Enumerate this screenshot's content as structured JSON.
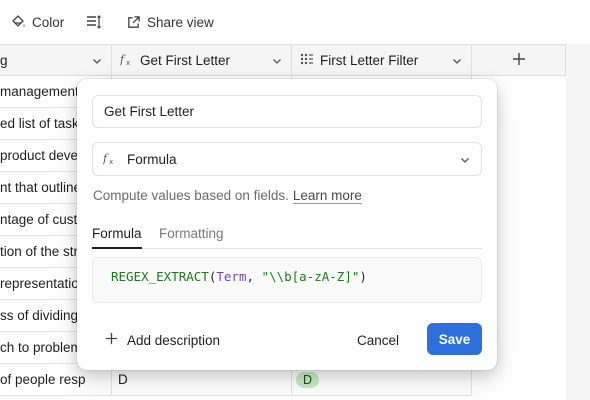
{
  "toolbar": {
    "color_label": "Color",
    "share_label": "Share view"
  },
  "columns": [
    {
      "label": "g"
    },
    {
      "label": "Get First Letter"
    },
    {
      "label": "First Letter Filter"
    }
  ],
  "rows": [
    {
      "c1": "management"
    },
    {
      "c1": "ed list of task"
    },
    {
      "c1": " product deve"
    },
    {
      "c1": "nt that outline"
    },
    {
      "c1": "ntage of custo"
    },
    {
      "c1": "tion of the stra"
    },
    {
      "c1": " representatio"
    },
    {
      "c1": "ss of dividing"
    },
    {
      "c1": "ch to problem"
    },
    {
      "c1": " of people resp",
      "c2": "D",
      "c3": "D"
    }
  ],
  "popup": {
    "name_value": "Get First Letter",
    "type_label": "Formula",
    "description": "Compute values based on fields.",
    "learn_more": "Learn more",
    "tabs": [
      {
        "label": "Formula",
        "active": true
      },
      {
        "label": "Formatting",
        "active": false
      }
    ],
    "formula": {
      "fn": "REGEX_EXTRACT",
      "open": "(",
      "ref": "Term",
      "sep": ", ",
      "str": "\"\\\\b[a-zA-Z]\"",
      "close": ")"
    },
    "add_description": "Add description",
    "cancel_label": "Cancel",
    "save_label": "Save"
  },
  "colors": {
    "accent": "#2d6fdc",
    "pill_bg": "#c7ecc5",
    "formula_fn": "#1d7a1d",
    "formula_ref": "#7044c8"
  }
}
